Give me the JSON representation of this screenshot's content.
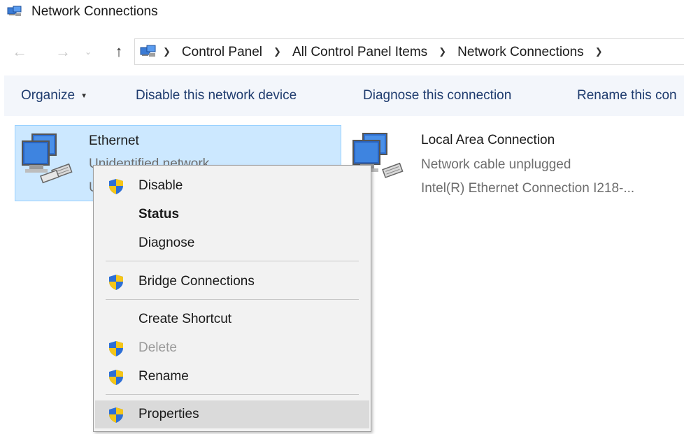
{
  "window": {
    "title": "Network Connections"
  },
  "nav": {
    "back_icon": "back-arrow-icon",
    "forward_icon": "forward-arrow-icon",
    "recent_icon": "chevron-down-icon",
    "up_icon": "up-arrow-icon",
    "breadcrumbs": [
      "Control Panel",
      "All Control Panel Items",
      "Network Connections"
    ]
  },
  "commands": {
    "organize": "Organize",
    "disable": "Disable this network device",
    "diagnose": "Diagnose this connection",
    "rename": "Rename this con"
  },
  "connections": [
    {
      "name": "Ethernet",
      "status": "Unidentified network",
      "device": "U",
      "selected": true
    },
    {
      "name": "Local Area Connection",
      "status": "Network cable unplugged",
      "device": "Intel(R) Ethernet Connection I218-..."
    }
  ],
  "context_menu": {
    "items": [
      {
        "label": "Disable",
        "shield": true
      },
      {
        "label": "Status",
        "bold": true
      },
      {
        "label": "Diagnose"
      },
      {
        "label": "Bridge Connections",
        "shield": true
      },
      {
        "label": "Create Shortcut"
      },
      {
        "label": "Delete",
        "shield": true,
        "disabled": true
      },
      {
        "label": "Rename",
        "shield": true
      },
      {
        "label": "Properties",
        "shield": true,
        "highlighted": true
      }
    ]
  },
  "colors": {
    "selection_bg": "#cce8ff",
    "command_text": "#1e3b6e",
    "shield_blue": "#2d6fd6",
    "shield_yellow": "#f5c518"
  }
}
